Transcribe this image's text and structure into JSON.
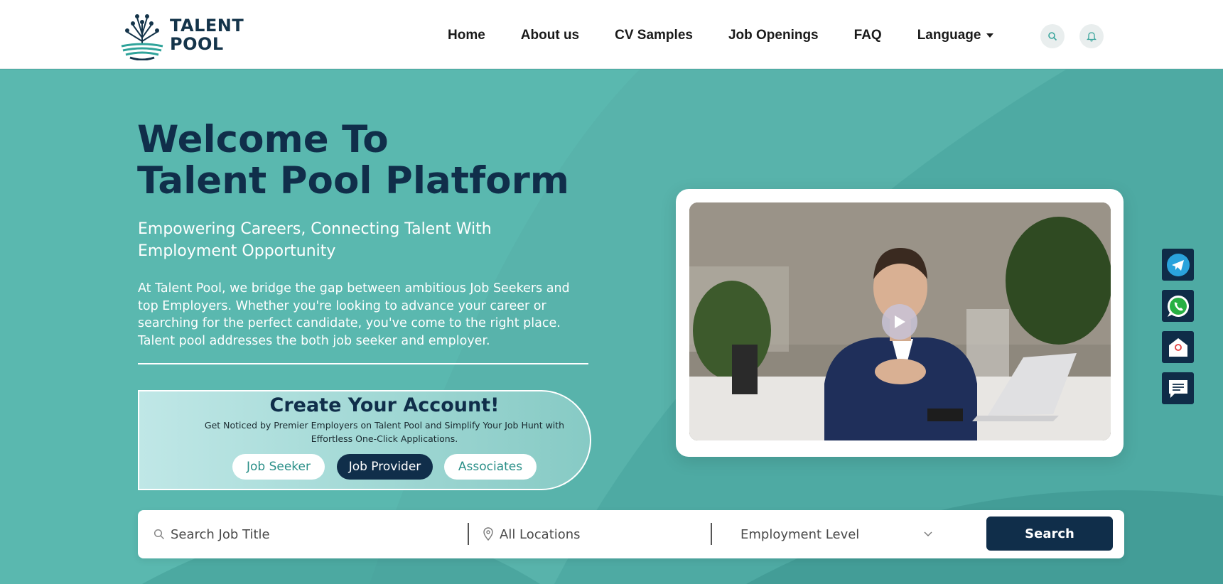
{
  "brand": {
    "line1": "TALENT",
    "line2": "POOL"
  },
  "nav": {
    "items": [
      "Home",
      "About us",
      "CV Samples",
      "Job Openings",
      "FAQ"
    ],
    "language_label": "Language"
  },
  "hero": {
    "title_line1": "Welcome To",
    "title_line2": "Talent Pool Platform",
    "subtitle": "Empowering Careers, Connecting Talent With Employment Opportunity",
    "description": "At Talent Pool, we bridge the gap between ambitious Job Seekers and top Employers. Whether you're looking to advance your career or searching for the perfect candidate, you've come to the right place. Talent pool addresses the both job seeker and employer."
  },
  "account": {
    "title": "Create Your Account!",
    "text": "Get Noticed by Premier Employers on Talent Pool and Simplify Your Job Hunt with Effortless One-Click Applications.",
    "buttons": [
      "Job Seeker",
      "Job Provider",
      "Associates"
    ]
  },
  "video": {
    "play_icon": "play-icon"
  },
  "social": [
    "telegram-icon",
    "whatsapp-icon",
    "email-icon",
    "chat-icon"
  ],
  "search": {
    "job_placeholder": "Search Job Title",
    "location_placeholder": "All Locations",
    "level_label": "Employment Level",
    "button_label": "Search"
  },
  "colors": {
    "navy": "#102e4a",
    "teal": "#4eaaa3",
    "white": "#ffffff"
  }
}
